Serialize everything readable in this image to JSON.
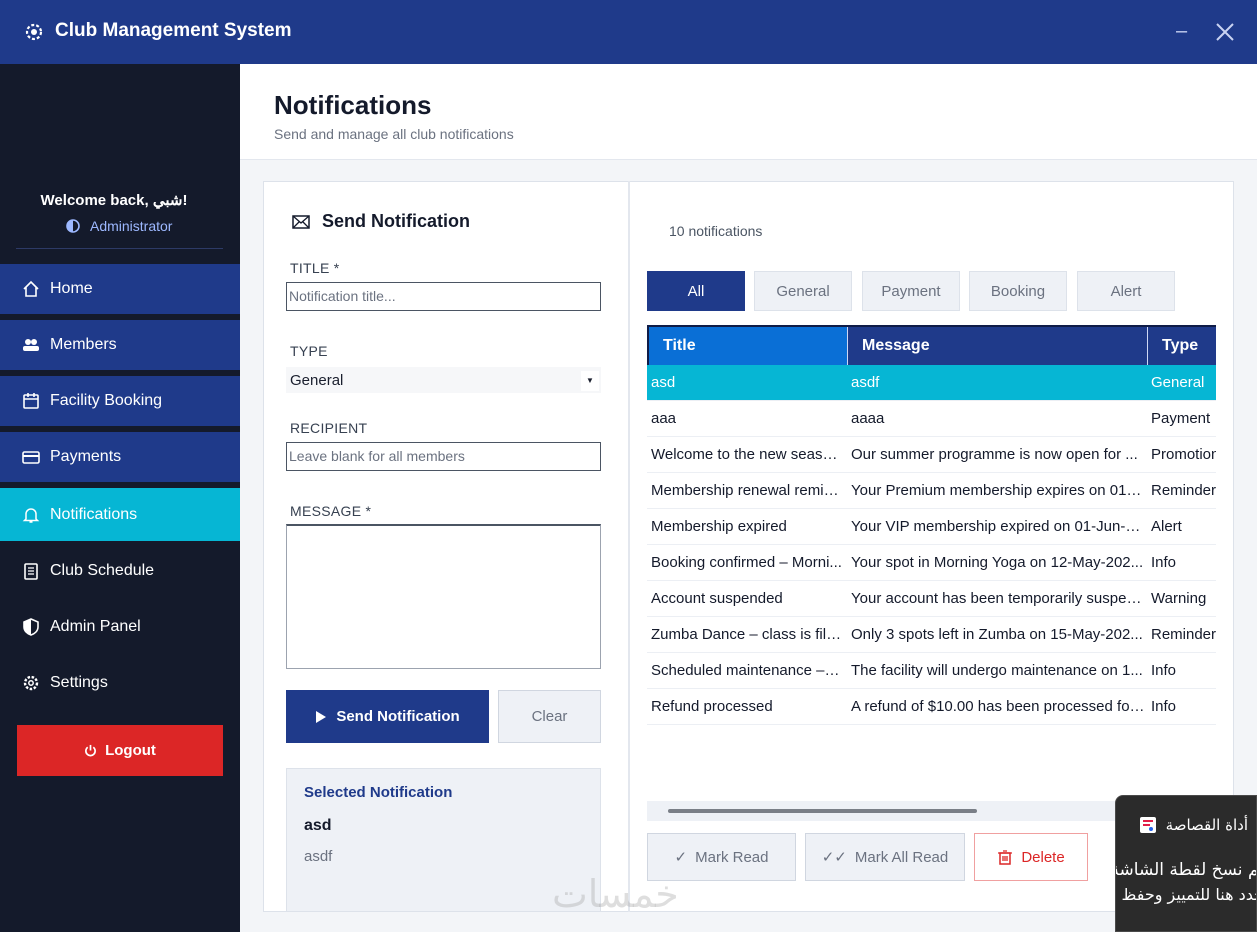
{
  "window": {
    "title": "Club Management System",
    "min_glyph": "–"
  },
  "sidebar": {
    "welcome": "Welcome back, شبي!",
    "role": "Administrator",
    "items": [
      {
        "label": "Home",
        "icon": "home-icon"
      },
      {
        "label": "Members",
        "icon": "users-icon"
      },
      {
        "label": "Facility Booking",
        "icon": "calendar-icon"
      },
      {
        "label": "Payments",
        "icon": "credit-card-icon"
      },
      {
        "label": "Notifications",
        "icon": "bell-icon",
        "active": true
      },
      {
        "label": "Club Schedule",
        "icon": "clipboard-icon"
      },
      {
        "label": "Admin Panel",
        "icon": "shield-icon"
      },
      {
        "label": "Settings",
        "icon": "gear-icon"
      }
    ],
    "logout": "Logout"
  },
  "header": {
    "title": "Notifications",
    "subtitle": "Send and manage all club notifications"
  },
  "form": {
    "title": "Send Notification",
    "title_label": "TITLE *",
    "title_placeholder": "Notification title...",
    "type_label": "TYPE",
    "type_value": "General",
    "recipient_label": "RECIPIENT",
    "recipient_placeholder": "Leave blank for all members",
    "message_label": "MESSAGE *",
    "send_label": "Send Notification",
    "clear_label": "Clear"
  },
  "selected": {
    "heading": "Selected Notification",
    "title": "asd",
    "message": "asdf"
  },
  "list": {
    "count": "10 notifications",
    "filters": [
      "All",
      "General",
      "Payment",
      "Booking",
      "Alert"
    ],
    "active_filter": "All",
    "columns": [
      "Title",
      "Message",
      "Type"
    ],
    "rows": [
      {
        "title": "asd",
        "message": "asdf",
        "type": "General"
      },
      {
        "title": "aaa",
        "message": "aaaa",
        "type": "Payment"
      },
      {
        "title": "Welcome to the new season!",
        "message": "Our summer programme is now open for ...",
        "type": "Promotion"
      },
      {
        "title": "Membership renewal remin...",
        "message": "Your Premium membership expires on 01-J...",
        "type": "Reminder"
      },
      {
        "title": "Membership expired",
        "message": "Your VIP membership expired on 01-Jun-2...",
        "type": "Alert"
      },
      {
        "title": "Booking confirmed – Morni...",
        "message": "Your spot in Morning Yoga on 12-May-202...",
        "type": "Info"
      },
      {
        "title": "Account suspended",
        "message": "Your account has been temporarily suspen...",
        "type": "Warning"
      },
      {
        "title": "Zumba Dance – class is filli...",
        "message": "Only 3 spots left in Zumba on 15-May-202...",
        "type": "Reminder"
      },
      {
        "title": "Scheduled maintenance – 1...",
        "message": "The facility will undergo maintenance on 1...",
        "type": "Info"
      },
      {
        "title": "Refund processed",
        "message": "A refund of $10.00 has been processed for...",
        "type": "Info"
      }
    ],
    "actions": {
      "mark_read": "Mark Read",
      "mark_all_read": "Mark All Read",
      "delete": "Delete"
    }
  },
  "toast": {
    "title": "أداة القصاصة",
    "line1": "تم نسخ لقطة الشاشة إلى الحافظة.",
    "line2": "حدد هنا للتمييز وحفظ لقطات الشاشة."
  },
  "watermark": "خمسات",
  "colors": {
    "primary": "#1f3a8a",
    "accent": "#06b6d4",
    "danger": "#dc2626",
    "sidebar_bg": "#141a2b"
  }
}
